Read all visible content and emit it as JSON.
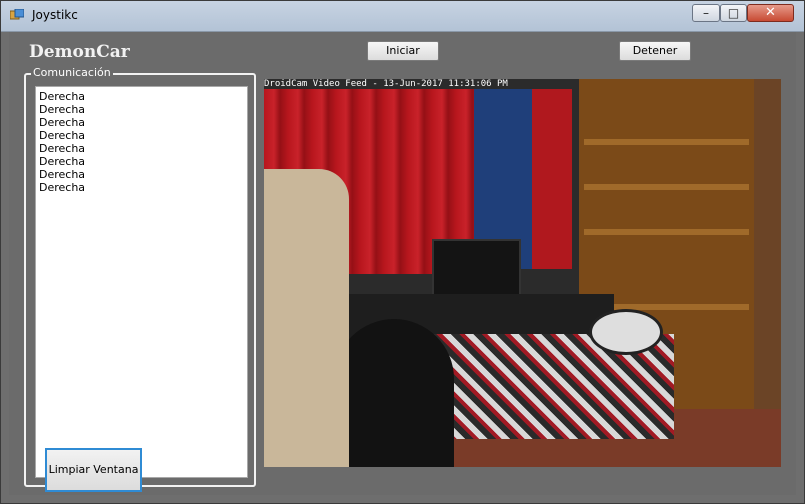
{
  "window": {
    "title": "Joystikc",
    "icon": "app-window-icon",
    "controls": {
      "minimize": "–",
      "maximize": "□",
      "close": "✕"
    }
  },
  "header": {
    "brand": "DemonCar",
    "start_label": "Iniciar",
    "stop_label": "Detener"
  },
  "communication": {
    "group_label": "Comunicación",
    "log_items": [
      "Derecha",
      "Derecha",
      "Derecha",
      "Derecha",
      "Derecha",
      "Derecha",
      "Derecha",
      "Derecha"
    ],
    "clear_label": "Limpiar Ventana"
  },
  "video": {
    "caption": "DroidCam Video Feed - 13-Jun-2017 11:31:06 PM"
  },
  "colors": {
    "accent": "#2f8bd4",
    "client_bg": "#6b6b6b"
  }
}
